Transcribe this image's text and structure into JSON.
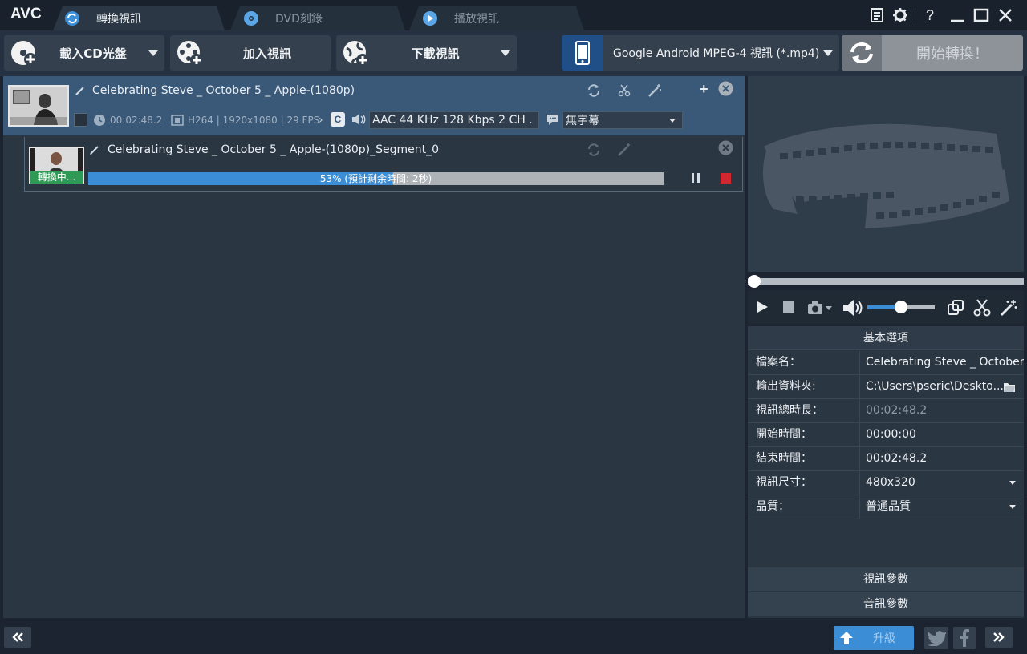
{
  "app": {
    "logo": "AVC"
  },
  "tabs": [
    {
      "label": "轉換視訊",
      "active": true
    },
    {
      "label": "DVD刻錄",
      "active": false
    },
    {
      "label": "播放視訊",
      "active": false
    }
  ],
  "toolbar": {
    "load_cd_label": "載入CD光盤",
    "add_video_label": "加入視訊",
    "download_video_label": "下載視訊",
    "profile_label": "Google Android MPEG-4 視訊 (*.mp4)",
    "start_label": "開始轉換！"
  },
  "file": {
    "name": "Celebrating Steve _ October 5 _ Apple-(1080p)",
    "duration": "00:02:48.2",
    "video_info": "H264 | 1920x1080 | 29 FPS",
    "audio_track": "AAC 44 KHz 128 Kbps 2 CH ...",
    "subtitle": "無字幕"
  },
  "segment": {
    "name": "Celebrating Steve _ October 5 _ Apple-(1080p)_Segment_0",
    "status": "轉換中...",
    "progress_text": "53% (預計剩余時間: 2秒)",
    "progress_percent": 53
  },
  "player": {
    "seek_position": 0,
    "volume_level": 0.5
  },
  "properties": {
    "header": "基本選項",
    "rows": [
      {
        "key": "檔案名：",
        "value": "Celebrating Steve _ October..."
      },
      {
        "key": "輸出資料夾:",
        "value": "C:\\Users\\pseric\\Deskto..."
      },
      {
        "key": "視訊總時長：",
        "value": "00:02:48.2"
      },
      {
        "key": "開始時間：",
        "value": "00:00:00"
      },
      {
        "key": "結束時間：",
        "value": "00:02:48.2"
      },
      {
        "key": "視訊尺寸：",
        "value": "480x320"
      },
      {
        "key": "品質：",
        "value": "普通品質"
      }
    ],
    "video_params": "視訊參數",
    "audio_params": "音訊參數"
  },
  "bottom": {
    "upgrade_label": "升級"
  },
  "colors": {
    "accent": "#3b8ed6",
    "selected_row": "#3a5877",
    "stop_red": "#d0282e"
  }
}
